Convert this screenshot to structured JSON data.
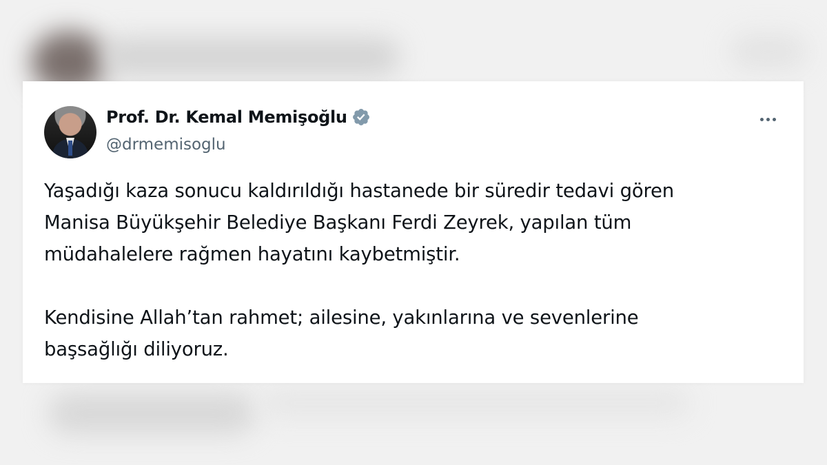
{
  "tweet": {
    "author": {
      "display_name": "Prof. Dr. Kemal Memişoğlu",
      "handle": "@drmemisoglu",
      "verified_icon": "verified-badge-icon",
      "verified_color": "#829aab"
    },
    "more_icon": "more-horizontal-icon",
    "paragraphs": [
      {
        "lines": [
          "Yaşadığı kaza sonucu kaldırıldığı hastanede bir süredir tedavi gören",
          "Manisa Büyükşehir Belediye Başkanı Ferdi Zeyrek, yapılan tüm",
          "müdahalelere rağmen hayatını kaybetmiştir."
        ]
      },
      {
        "lines": [
          "Kendisine Allah’tan rahmet; ailesine, yakınlarına ve sevenlerine",
          "başsağlığı diliyoruz."
        ]
      }
    ]
  }
}
